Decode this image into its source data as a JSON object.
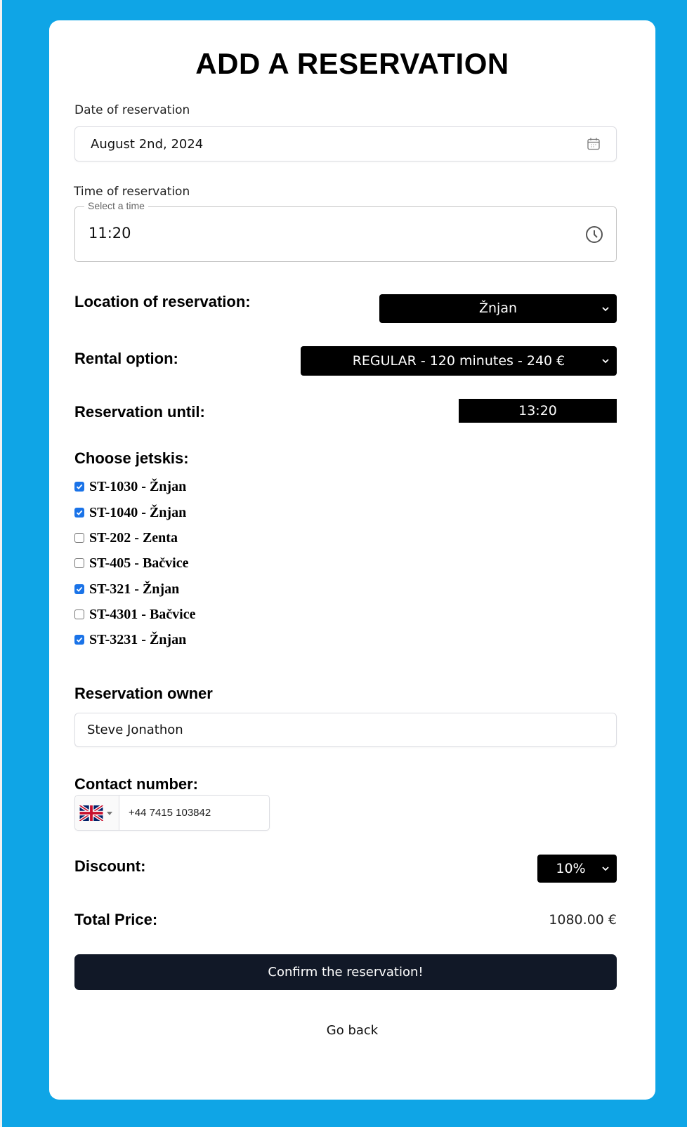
{
  "page": {
    "title": "ADD A RESERVATION"
  },
  "date": {
    "label": "Date of reservation",
    "value": "August 2nd, 2024",
    "icon": "calendar-icon"
  },
  "time": {
    "label": "Time of reservation",
    "legend": "Select a time",
    "value": "11:20",
    "icon": "clock-icon"
  },
  "location": {
    "label": "Location of reservation:",
    "selected": "Žnjan"
  },
  "rental": {
    "label": "Rental option:",
    "selected": "REGULAR - 120 minutes - 240 €"
  },
  "until": {
    "label": "Reservation until:",
    "value": "13:20"
  },
  "jetskis": {
    "label": "Choose jetskis:",
    "items": [
      {
        "label": "ST-1030 - Žnjan",
        "checked": true
      },
      {
        "label": "ST-1040 - Žnjan",
        "checked": true
      },
      {
        "label": "ST-202 - Zenta",
        "checked": false
      },
      {
        "label": "ST-405 - Bačvice",
        "checked": false
      },
      {
        "label": "ST-321 - Žnjan",
        "checked": true
      },
      {
        "label": "ST-4301 - Bačvice",
        "checked": false
      },
      {
        "label": "ST-3231 - Žnjan",
        "checked": true
      }
    ]
  },
  "owner": {
    "label": "Reservation owner",
    "value": "Steve Jonathon"
  },
  "contact": {
    "label": "Contact number:",
    "value": "+44 7415 103842",
    "country_icon": "uk-flag-icon"
  },
  "discount": {
    "label": "Discount:",
    "selected": "10%"
  },
  "total": {
    "label": "Total Price:",
    "value": "1080.00 €"
  },
  "actions": {
    "confirm_label": "Confirm the reservation!",
    "back_label": "Go back"
  },
  "colors": {
    "background": "#0fa5e6",
    "checkbox": "#1a73e8",
    "button": "#111827"
  }
}
